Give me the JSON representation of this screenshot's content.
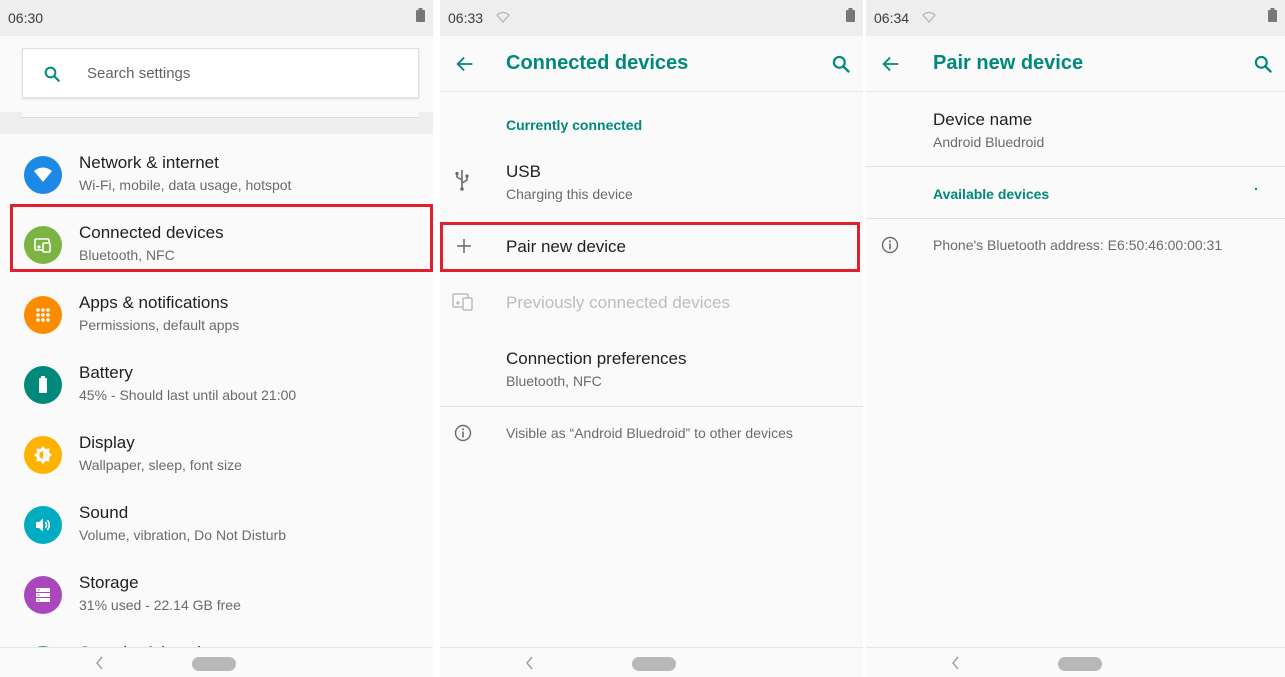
{
  "panel1": {
    "status_time": "06:30",
    "search_placeholder": "Search settings",
    "items": [
      {
        "title": "Network & internet",
        "subtitle": "Wi-Fi, mobile, data usage, hotspot",
        "icon": "wifi-icon",
        "color": "#1e88e5"
      },
      {
        "title": "Connected devices",
        "subtitle": "Bluetooth, NFC",
        "icon": "devices-icon",
        "color": "#7cb342"
      },
      {
        "title": "Apps & notifications",
        "subtitle": "Permissions, default apps",
        "icon": "apps-icon",
        "color": "#fb8c00"
      },
      {
        "title": "Battery",
        "subtitle": "45% - Should last until about 21:00",
        "icon": "battery-icon",
        "color": "#00897b"
      },
      {
        "title": "Display",
        "subtitle": "Wallpaper, sleep, font size",
        "icon": "brightness-icon",
        "color": "#ffb300"
      },
      {
        "title": "Sound",
        "subtitle": "Volume, vibration, Do Not Disturb",
        "icon": "volume-icon",
        "color": "#00acc1"
      },
      {
        "title": "Storage",
        "subtitle": "31% used - 22.14 GB free",
        "icon": "storage-icon",
        "color": "#ab47bc"
      },
      {
        "title": "Security & location",
        "subtitle": "",
        "icon": "security-icon",
        "color": "#43a047"
      }
    ]
  },
  "panel2": {
    "status_time": "06:33",
    "title": "Connected devices",
    "section_currently_connected": "Currently connected",
    "usb_title": "USB",
    "usb_subtitle": "Charging this device",
    "pair_new_device": "Pair new device",
    "previously_connected": "Previously connected devices",
    "connection_preferences": "Connection preferences",
    "connection_preferences_sub": "Bluetooth, NFC",
    "visible_info": "Visible as “Android Bluedroid” to other devices"
  },
  "panel3": {
    "status_time": "06:34",
    "title": "Pair new device",
    "device_name_label": "Device name",
    "device_name_value": "Android Bluedroid",
    "section_available": "Available devices",
    "bt_address": "Phone's Bluetooth address: E6:50:46:00:00:31"
  },
  "colors": {
    "accent": "#00897b",
    "highlight": "#e0202c"
  }
}
